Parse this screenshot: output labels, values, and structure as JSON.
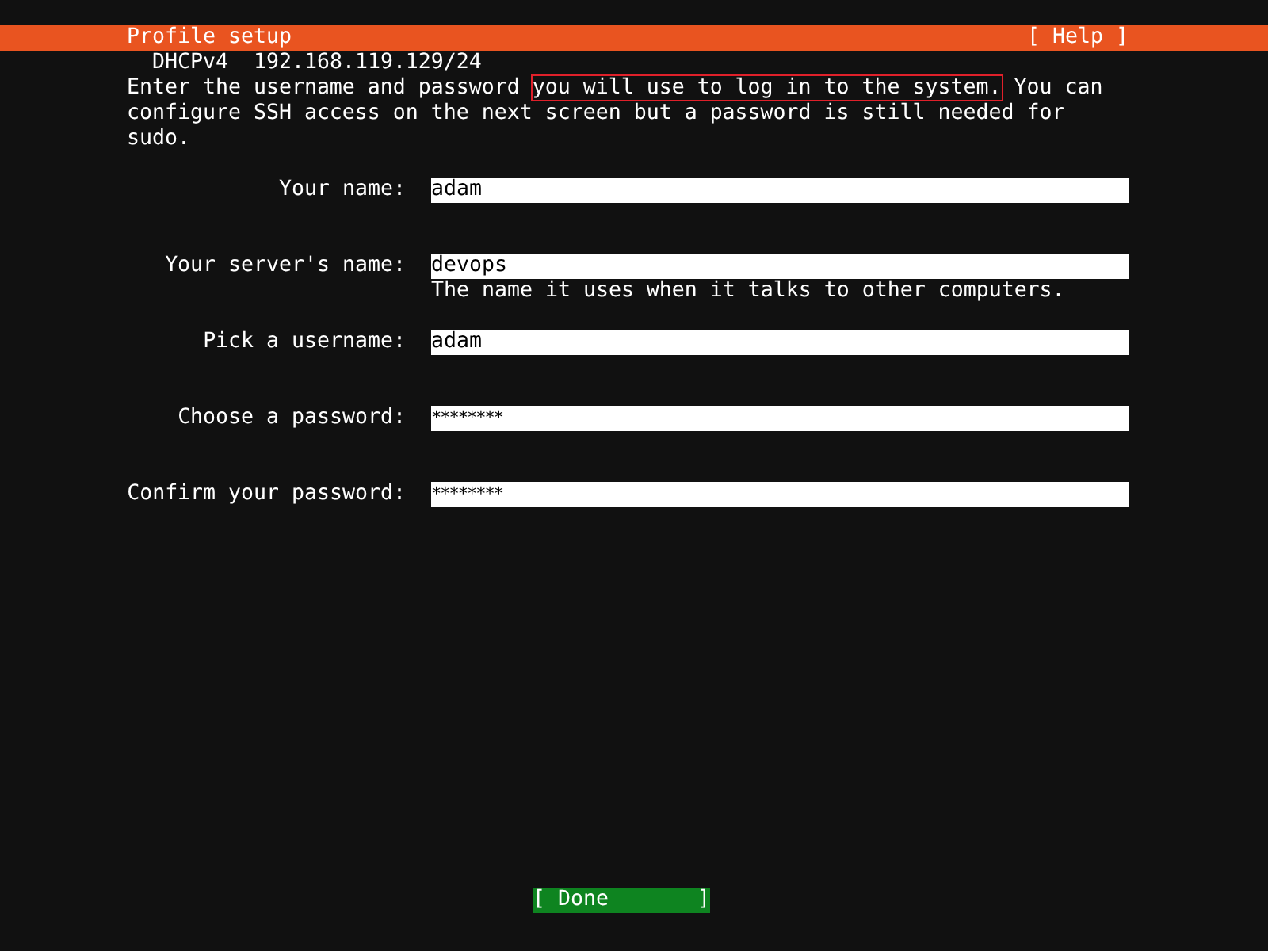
{
  "header": {
    "title": "Profile setup",
    "help": "[ Help ]"
  },
  "network": {
    "interface": "DHCPv4",
    "address": "192.168.119.129/24"
  },
  "intro": {
    "before": "Enter the username and password ",
    "highlighted": "you will use to log in to the system.",
    "after": " You can configure SSH access on the next screen but a password is still needed for sudo."
  },
  "fields": [
    {
      "label": "Your name:",
      "value": "adam",
      "kind": "text"
    },
    {
      "label": "Your server's name:",
      "value": "devops",
      "kind": "text",
      "hint": "The name it uses when it talks to other computers."
    },
    {
      "label": "Pick a username:",
      "value": "adam",
      "kind": "text"
    },
    {
      "label": "Choose a password:",
      "value": "********",
      "kind": "password"
    },
    {
      "label": "Confirm your password:",
      "value": "********",
      "kind": "password"
    }
  ],
  "done_button": {
    "label": "[ Done       ]"
  }
}
